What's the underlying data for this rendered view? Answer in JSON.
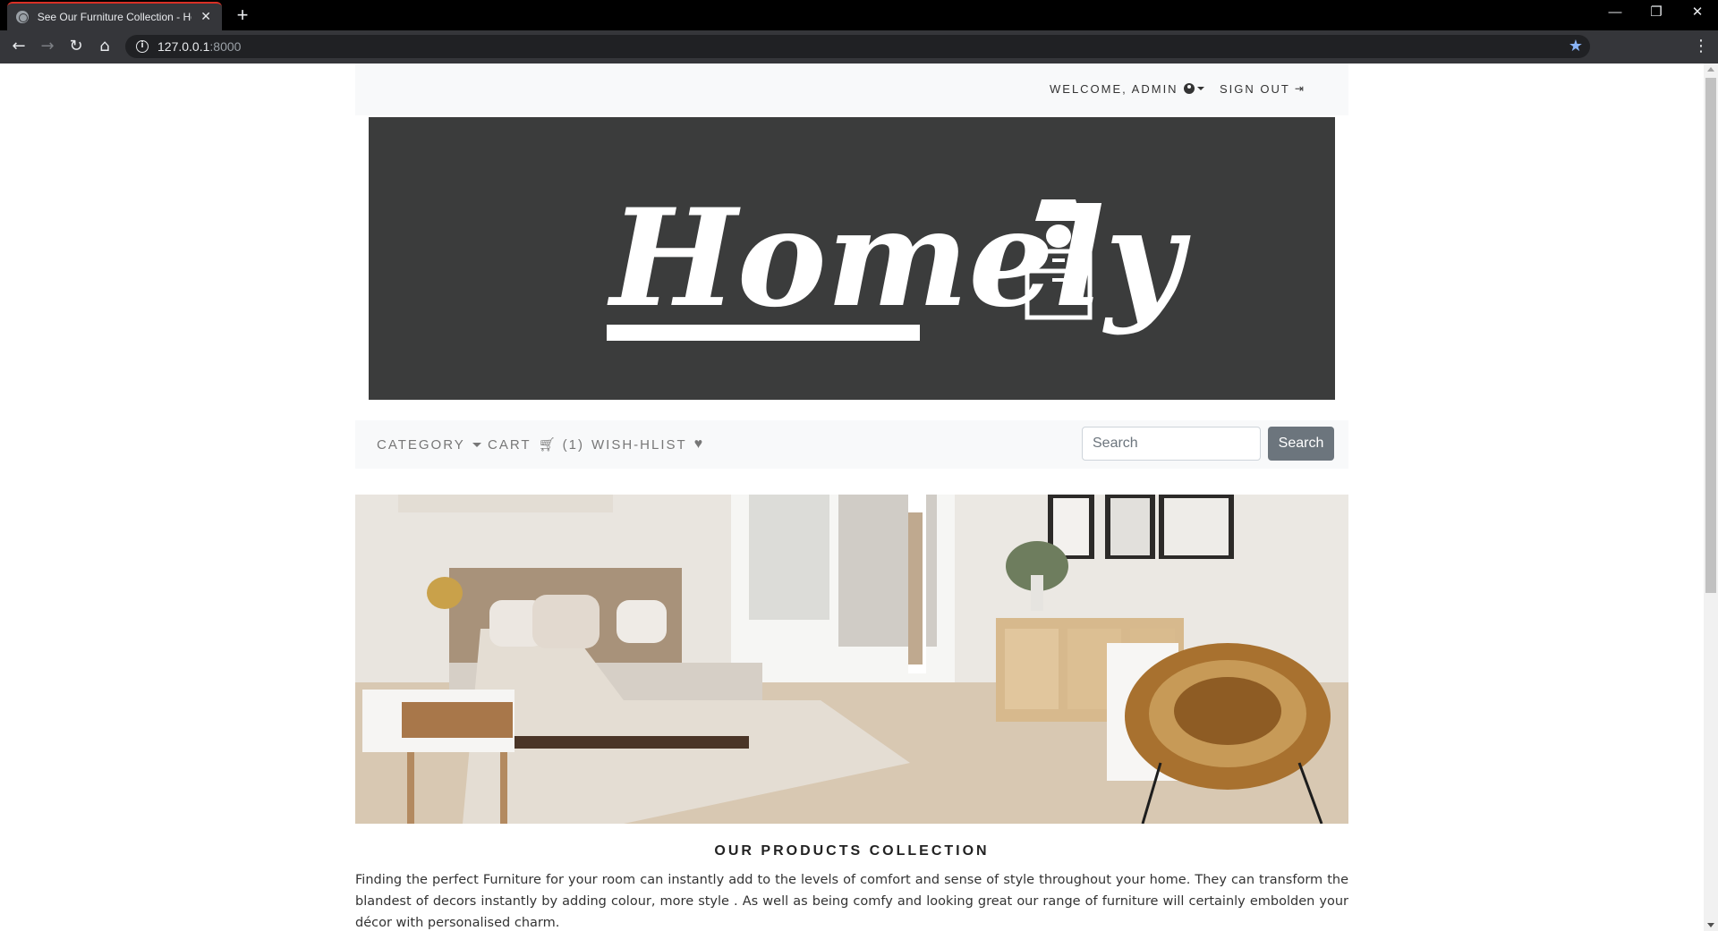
{
  "browser": {
    "tab_title": "See Our Furniture Collection - Homely",
    "url_host": "127.0.0.1",
    "url_port": ":8000"
  },
  "topnav": {
    "welcome_label": "WELCOME, ADMIN",
    "signout_label": "SIGN OUT"
  },
  "banner": {
    "logo_text": "Homely"
  },
  "subnav": {
    "category_label": "CATEGORY",
    "cart_label": "CART",
    "cart_count": "(1)",
    "wishlist_label": "WISH-HLIST",
    "search_placeholder": "Search",
    "search_button": "Search"
  },
  "main": {
    "section_title": "OUR PRODUCTS COLLECTION",
    "intro_text": "Finding the perfect Furniture for your room can instantly add to the levels of comfort and sense of style throughout your home. They can transform the blandest of decors instantly by adding colour, more style . As well as being comfy and looking great our range of furniture will certainly embolden your décor with personalised charm."
  },
  "colors": {
    "banner_bg": "#3b3c3c",
    "nav_bg": "#f8f9fa",
    "search_button_bg": "#6c757d",
    "star_blue": "#8ab4f8"
  }
}
